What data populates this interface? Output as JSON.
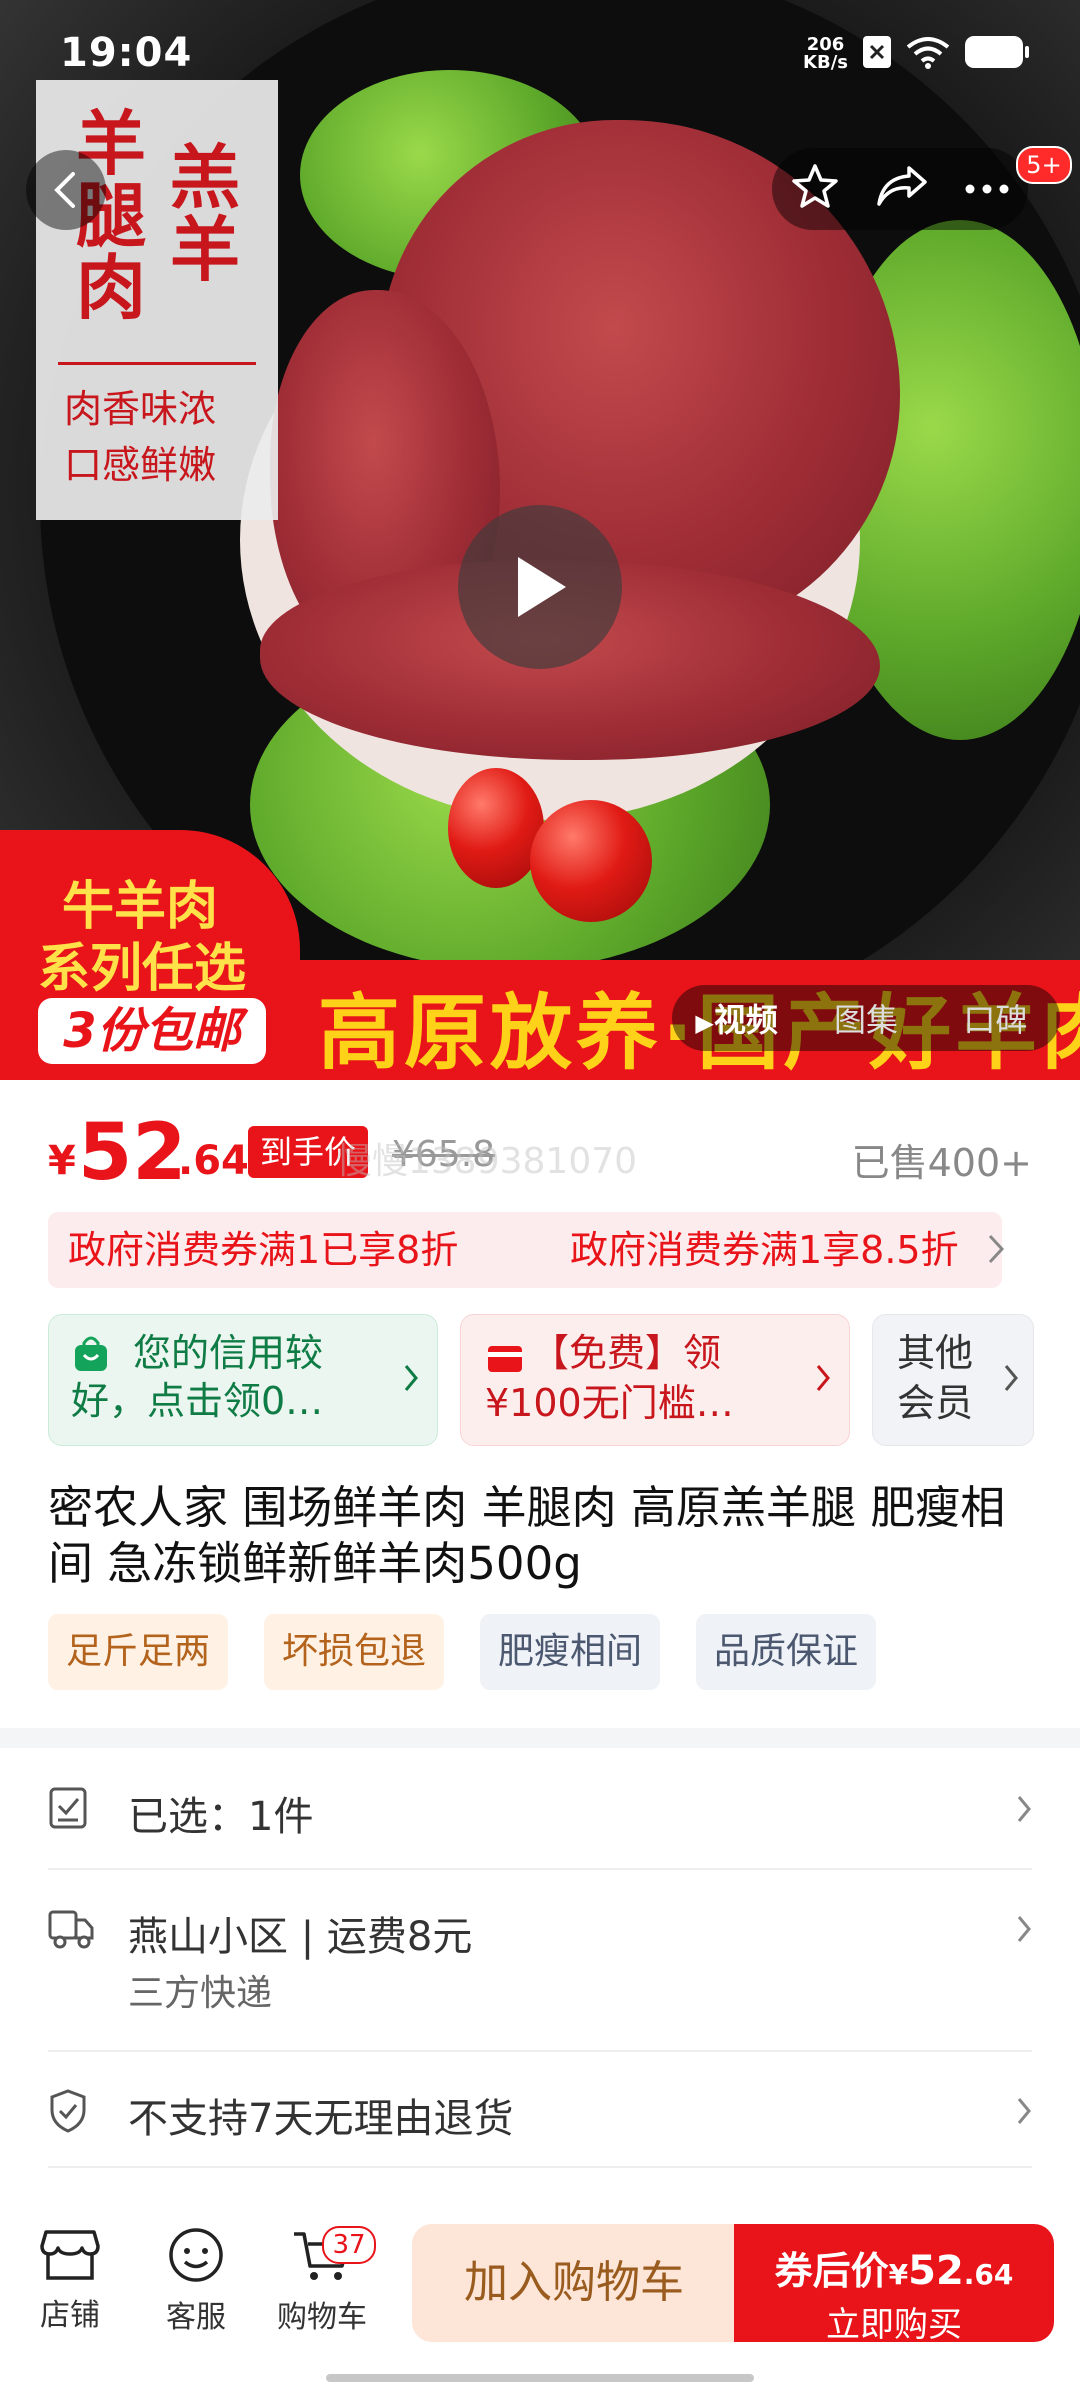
{
  "status_bar": {
    "time": "19:04",
    "speed_value": "206",
    "speed_unit": "KB/s"
  },
  "hero": {
    "badge_chars": [
      "羊",
      "腿",
      "肉",
      "羔",
      "羊"
    ],
    "badge_sub1": "肉香味浓",
    "badge_sub2": "口感鲜嫩",
    "promo_line1": "牛羊肉",
    "promo_line2": "系列任选",
    "promo_pill": "3份包邮",
    "banner_text": "高原放养·国产好羊肉",
    "nav_badge": "5+",
    "media_tabs": [
      "视频",
      "图集",
      "口碑"
    ]
  },
  "price": {
    "currency": "¥",
    "integer": "52",
    "decimal": ".64",
    "final_label": "到手价",
    "original": "¥65.8",
    "watermark": "慢慢1389381070",
    "sold": "已售400+"
  },
  "coupons": [
    "政府消费券满1已享8折",
    "政府消费券满1享8.5折"
  ],
  "cards": {
    "credit": "您的信用较好，点击领0…",
    "free_l1": "【免费】领",
    "free_l2": "¥100无门槛…",
    "member_l1": "其他",
    "member_l2": "会员"
  },
  "product_title": "密农人家 围场鲜羊肉 羊腿肉 高原羔羊腿  肥瘦相间 急冻锁鲜新鲜羊肉500g",
  "tags": [
    "足斤足两",
    "坏损包退",
    "肥瘦相间",
    "品质保证"
  ],
  "rows": {
    "selected": "已选：1件",
    "address": "燕山小区 | 运费8元",
    "delivery": "三方快递",
    "return_policy": "不支持7天无理由退货"
  },
  "bottom_bar": {
    "shop": "店铺",
    "service": "客服",
    "cart": "购物车",
    "cart_count": "37",
    "add_to_cart": "加入购物车",
    "coupon_price_label": "券后价",
    "coupon_price_currency": "¥",
    "coupon_price_int": "52",
    "coupon_price_dec": ".64",
    "buy_now": "立即购买"
  },
  "colors": {
    "accent_red": "#e8141a",
    "banner_yellow": "#ffd21a",
    "credit_green": "#13a35a"
  }
}
